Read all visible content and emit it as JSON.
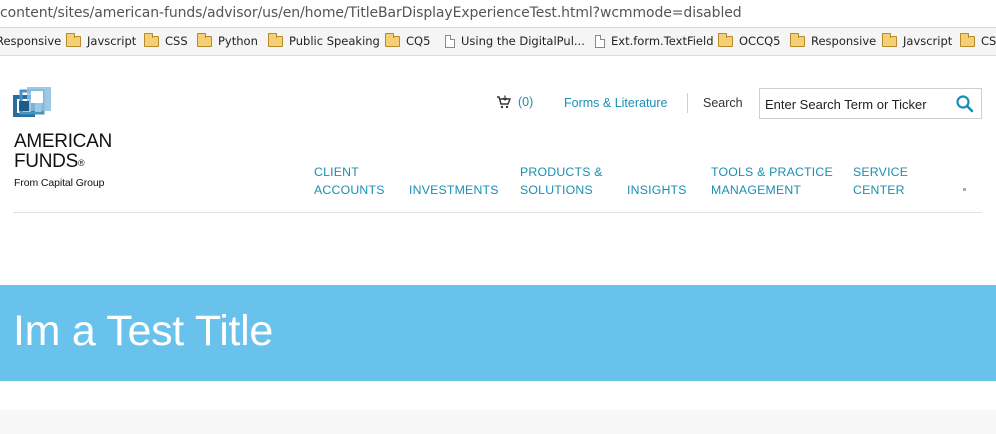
{
  "browser": {
    "url": "content/sites/american-funds/advisor/us/en/home/TitleBarDisplayExperienceTest.html?wcmmode=disabled",
    "bookmarks": [
      {
        "label": "Responsive",
        "icon": "folder-icon"
      },
      {
        "label": "Javscript",
        "icon": "folder-icon"
      },
      {
        "label": "CSS",
        "icon": "folder-icon"
      },
      {
        "label": "Python",
        "icon": "folder-icon"
      },
      {
        "label": "Public Speaking",
        "icon": "folder-icon"
      },
      {
        "label": "CQ5",
        "icon": "folder-icon"
      },
      {
        "label": "Using the DigitalPul...",
        "icon": "page-icon"
      },
      {
        "label": "Ext.form.TextField",
        "icon": "page-icon"
      },
      {
        "label": "OCCQ5",
        "icon": "folder-icon"
      },
      {
        "label": "Responsive",
        "icon": "folder-icon"
      },
      {
        "label": "Javscript",
        "icon": "folder-icon"
      },
      {
        "label": "CS",
        "icon": "folder-icon"
      }
    ]
  },
  "header": {
    "logo": {
      "line1": "AMERICAN",
      "line2": "FUNDS",
      "registered": "®",
      "tagline": "From Capital Group"
    },
    "cart": {
      "count": "(0)",
      "icon": "cart-icon"
    },
    "forms_link": "Forms & Literature",
    "search": {
      "label": "Search",
      "placeholder": "Enter Search Term or Ticker",
      "icon": "search-icon"
    },
    "nav": [
      {
        "line1": "CLIENT",
        "line2": "ACCOUNTS"
      },
      {
        "line1": "",
        "line2": "INVESTMENTS"
      },
      {
        "line1": "PRODUCTS &",
        "line2": "SOLUTIONS"
      },
      {
        "line1": "",
        "line2": "INSIGHTS"
      },
      {
        "line1": "TOOLS & PRACTICE",
        "line2": "MANAGEMENT"
      },
      {
        "line1": "SERVICE",
        "line2": "CENTER"
      }
    ]
  },
  "title_bar": {
    "title": "Im a Test Title",
    "background": "#69c2ec"
  },
  "colors": {
    "link": "#1a8fb4",
    "title_bar": "#69c2ec",
    "logo_blue_dark": "#1f5b87",
    "logo_blue_light": "#6aa8cf"
  }
}
